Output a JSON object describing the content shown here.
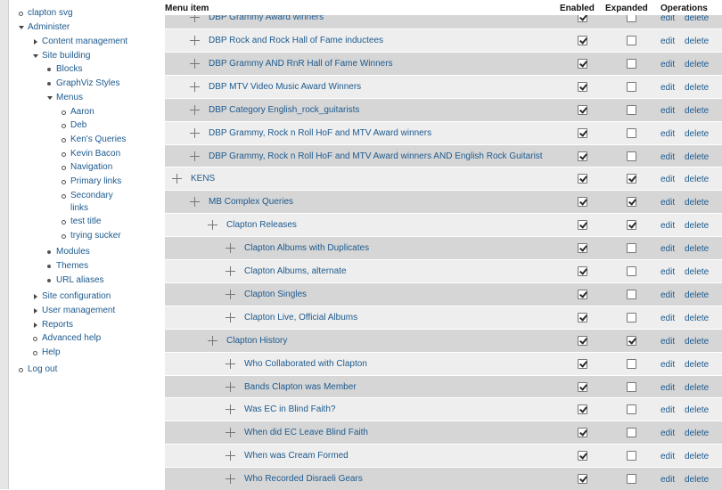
{
  "sidebar": {
    "items": [
      {
        "label": "clapton svg",
        "level": 0,
        "marker": "bullet-open"
      },
      {
        "label": "Administer",
        "level": 0,
        "marker": "tri-down"
      },
      {
        "label": "Content management",
        "level": 1,
        "marker": "tri-right"
      },
      {
        "label": "Site building",
        "level": 1,
        "marker": "tri-down"
      },
      {
        "label": "Blocks",
        "level": 2,
        "marker": "bullet-solid"
      },
      {
        "label": "GraphViz Styles",
        "level": 2,
        "marker": "bullet-solid"
      },
      {
        "label": "Menus",
        "level": 2,
        "marker": "tri-down"
      },
      {
        "label": "Aaron",
        "level": 3,
        "marker": "bullet-open"
      },
      {
        "label": "Deb",
        "level": 3,
        "marker": "bullet-open"
      },
      {
        "label": "Ken's Queries",
        "level": 3,
        "marker": "bullet-open"
      },
      {
        "label": "Kevin Bacon",
        "level": 3,
        "marker": "bullet-open"
      },
      {
        "label": "Navigation",
        "level": 3,
        "marker": "bullet-open"
      },
      {
        "label": "Primary links",
        "level": 3,
        "marker": "bullet-open"
      },
      {
        "label": "Secondary",
        "level": 3,
        "marker": "bullet-open"
      },
      {
        "label": "links",
        "level": 3,
        "marker": "none"
      },
      {
        "label": "test title",
        "level": 3,
        "marker": "bullet-open"
      },
      {
        "label": "trying sucker",
        "level": 3,
        "marker": "bullet-open"
      },
      {
        "label": "Modules",
        "level": 2,
        "marker": "bullet-solid"
      },
      {
        "label": "Themes",
        "level": 2,
        "marker": "bullet-solid"
      },
      {
        "label": "URL aliases",
        "level": 2,
        "marker": "bullet-solid"
      },
      {
        "label": "Site configuration",
        "level": 1,
        "marker": "tri-right"
      },
      {
        "label": "User management",
        "level": 1,
        "marker": "tri-right"
      },
      {
        "label": "Reports",
        "level": 1,
        "marker": "tri-right"
      },
      {
        "label": "Advanced help",
        "level": 1,
        "marker": "bullet-open"
      },
      {
        "label": "Help",
        "level": 1,
        "marker": "bullet-open"
      },
      {
        "label": "Log out",
        "level": 0,
        "marker": "bullet-open"
      }
    ]
  },
  "table": {
    "headers": {
      "menu_item": "Menu item",
      "enabled": "Enabled",
      "expanded": "Expanded",
      "operations": "Operations"
    },
    "edit_label": "edit",
    "delete_label": "delete",
    "partial_row": {
      "label": "DBP Grammy Award winners",
      "depth": 1,
      "enabled": true,
      "expanded": false
    },
    "rows": [
      {
        "label": "DBP Rock and Rock Hall of Fame inductees",
        "depth": 1,
        "enabled": true,
        "expanded": false
      },
      {
        "label": "DBP Grammy AND RnR Hall of Fame Winners",
        "depth": 1,
        "enabled": true,
        "expanded": false
      },
      {
        "label": "DBP MTV Video Music Award Winners",
        "depth": 1,
        "enabled": true,
        "expanded": false
      },
      {
        "label": "DBP Category English_rock_guitarists",
        "depth": 1,
        "enabled": true,
        "expanded": false
      },
      {
        "label": "DBP Grammy, Rock n Roll HoF and MTV Award winners",
        "depth": 1,
        "enabled": true,
        "expanded": false
      },
      {
        "label": "DBP Grammy, Rock n Roll HoF and MTV Award winners AND English Rock Guitarist",
        "depth": 1,
        "enabled": true,
        "expanded": false
      },
      {
        "label": "KENS",
        "depth": 0,
        "enabled": true,
        "expanded": true
      },
      {
        "label": "MB Complex Queries",
        "depth": 1,
        "enabled": true,
        "expanded": true
      },
      {
        "label": "Clapton Releases",
        "depth": 2,
        "enabled": true,
        "expanded": true
      },
      {
        "label": "Clapton Albums with Duplicates",
        "depth": 3,
        "enabled": true,
        "expanded": false
      },
      {
        "label": "Clapton Albums, alternate",
        "depth": 3,
        "enabled": true,
        "expanded": false
      },
      {
        "label": "Clapton Singles",
        "depth": 3,
        "enabled": true,
        "expanded": false
      },
      {
        "label": "Clapton Live, Official Albums",
        "depth": 3,
        "enabled": true,
        "expanded": false
      },
      {
        "label": "Clapton History",
        "depth": 2,
        "enabled": true,
        "expanded": true
      },
      {
        "label": "Who Collaborated with Clapton",
        "depth": 3,
        "enabled": true,
        "expanded": false
      },
      {
        "label": "Bands Clapton was Member",
        "depth": 3,
        "enabled": true,
        "expanded": false
      },
      {
        "label": "Was EC in Blind Faith?",
        "depth": 3,
        "enabled": true,
        "expanded": false
      },
      {
        "label": "When did EC Leave Blind Faith",
        "depth": 3,
        "enabled": true,
        "expanded": false
      },
      {
        "label": "When was Cream Formed",
        "depth": 3,
        "enabled": true,
        "expanded": false
      },
      {
        "label": "Who Recorded Disraeli Gears",
        "depth": 3,
        "enabled": true,
        "expanded": false
      }
    ]
  }
}
